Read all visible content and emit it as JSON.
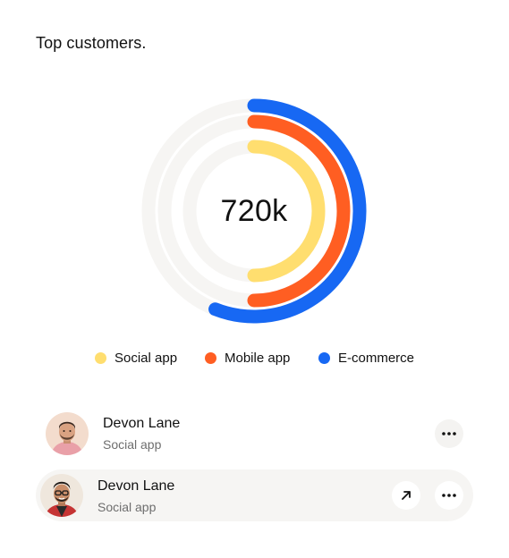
{
  "card": {
    "title": "Top customers."
  },
  "chart_data": {
    "type": "radial-bar",
    "center_label": "720k",
    "series": [
      {
        "name": "Social app",
        "color": "#FFDE6F",
        "fraction": 0.5
      },
      {
        "name": "Mobile app",
        "color": "#FF5E22",
        "fraction": 0.5
      },
      {
        "name": "E-commerce",
        "color": "#1768F3",
        "fraction": 0.56
      }
    ],
    "track_color": "#F6F5F3"
  },
  "legend": [
    {
      "label": "Social app",
      "color": "#FFDE6F"
    },
    {
      "label": "Mobile app",
      "color": "#FF5E22"
    },
    {
      "label": "E-commerce",
      "color": "#1768F3"
    }
  ],
  "customers": [
    {
      "name": "Devon Lane",
      "category": "Social app",
      "more_icon": "more-horizontal-icon",
      "avatar_icon": "avatar-image"
    },
    {
      "name": "Devon Lane",
      "category": "Social app",
      "open_icon": "arrow-up-right-icon",
      "more_icon": "more-horizontal-icon",
      "avatar_icon": "avatar-image"
    }
  ]
}
